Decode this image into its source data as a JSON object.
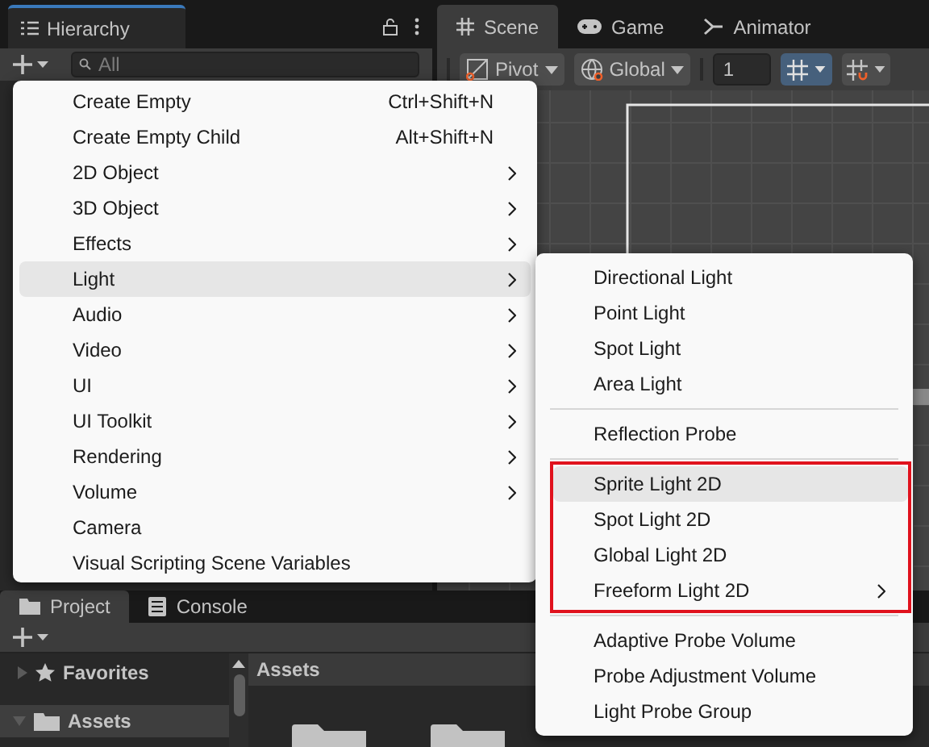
{
  "hierarchy": {
    "title": "Hierarchy",
    "search_placeholder": "All"
  },
  "scene_tabs": [
    {
      "label": "Scene",
      "selected": true
    },
    {
      "label": "Game",
      "selected": false
    },
    {
      "label": "Animator",
      "selected": false
    }
  ],
  "scene_toolbar": {
    "pivot": "Pivot",
    "space": "Global",
    "increment": "1"
  },
  "create_menu": [
    {
      "label": "Create Empty",
      "shortcut": "Ctrl+Shift+N",
      "has_submenu": false,
      "selected": false
    },
    {
      "label": "Create Empty Child",
      "shortcut": "Alt+Shift+N",
      "has_submenu": false,
      "selected": false
    },
    {
      "label": "2D Object",
      "has_submenu": true,
      "selected": false
    },
    {
      "label": "3D Object",
      "has_submenu": true,
      "selected": false
    },
    {
      "label": "Effects",
      "has_submenu": true,
      "selected": false
    },
    {
      "label": "Light",
      "has_submenu": true,
      "selected": true
    },
    {
      "label": "Audio",
      "has_submenu": true,
      "selected": false
    },
    {
      "label": "Video",
      "has_submenu": true,
      "selected": false
    },
    {
      "label": "UI",
      "has_submenu": true,
      "selected": false
    },
    {
      "label": "UI Toolkit",
      "has_submenu": true,
      "selected": false
    },
    {
      "label": "Rendering",
      "has_submenu": true,
      "selected": false
    },
    {
      "label": "Volume",
      "has_submenu": true,
      "selected": false
    },
    {
      "label": "Camera",
      "has_submenu": false,
      "selected": false
    },
    {
      "label": "Visual Scripting Scene Variables",
      "has_submenu": false,
      "selected": false
    }
  ],
  "light_submenu": [
    {
      "boxed": false,
      "items": [
        {
          "label": "Directional Light",
          "has_submenu": false,
          "selected": false
        },
        {
          "label": "Point Light",
          "has_submenu": false,
          "selected": false
        },
        {
          "label": "Spot Light",
          "has_submenu": false,
          "selected": false
        },
        {
          "label": "Area Light",
          "has_submenu": false,
          "selected": false
        }
      ]
    },
    {
      "boxed": false,
      "items": [
        {
          "label": "Reflection Probe",
          "has_submenu": false,
          "selected": false
        }
      ]
    },
    {
      "boxed": true,
      "items": [
        {
          "label": "Sprite Light 2D",
          "has_submenu": false,
          "selected": true
        },
        {
          "label": "Spot Light 2D",
          "has_submenu": false,
          "selected": false
        },
        {
          "label": "Global Light 2D",
          "has_submenu": false,
          "selected": false
        },
        {
          "label": "Freeform Light 2D",
          "has_submenu": true,
          "selected": false
        }
      ]
    },
    {
      "boxed": false,
      "items": [
        {
          "label": "Adaptive Probe Volume",
          "has_submenu": false,
          "selected": false
        },
        {
          "label": "Probe Adjustment Volume",
          "has_submenu": false,
          "selected": false
        },
        {
          "label": "Light Probe Group",
          "has_submenu": false,
          "selected": false
        }
      ]
    }
  ],
  "bottom_tabs": [
    {
      "label": "Project",
      "selected": true
    },
    {
      "label": "Console",
      "selected": false
    }
  ],
  "project": {
    "favorites": "Favorites",
    "assets_tree": "Assets",
    "assets_header": "Assets"
  }
}
